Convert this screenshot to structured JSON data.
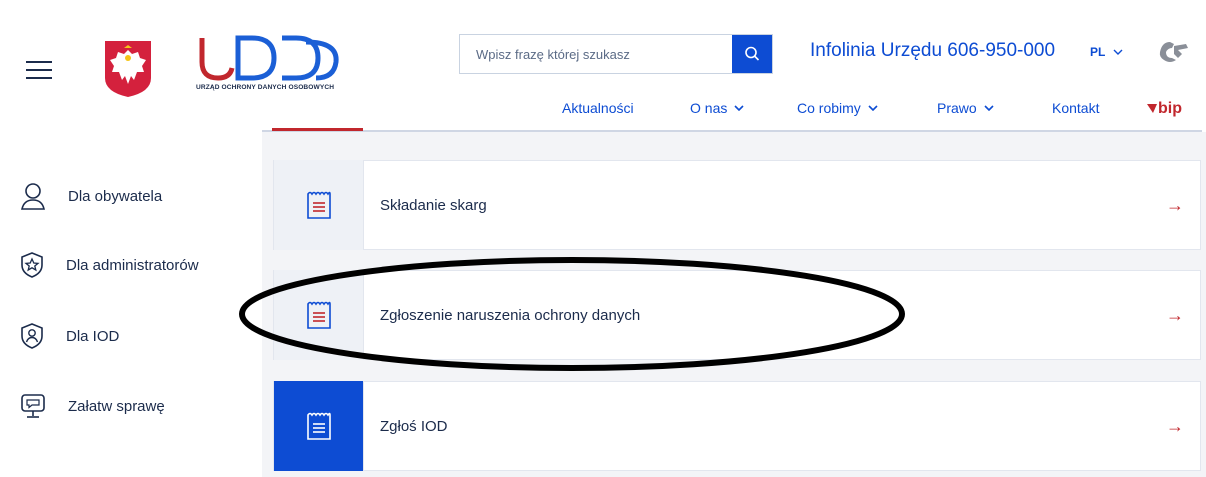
{
  "header": {
    "logo_text": "UODO",
    "logo_subtitle": "URZĄD OCHRONY DANYCH OSOBOWYCH",
    "search_placeholder": "Wpisz frazę której szukasz",
    "hotline": "Infolinia Urzędu 606-950-000",
    "language": "PL",
    "bip_label": "bip"
  },
  "nav": [
    {
      "label": "Aktualności",
      "has_dropdown": false
    },
    {
      "label": "O nas",
      "has_dropdown": true
    },
    {
      "label": "Co robimy",
      "has_dropdown": true
    },
    {
      "label": "Prawo",
      "has_dropdown": true
    },
    {
      "label": "Kontakt",
      "has_dropdown": false
    }
  ],
  "sidebar": {
    "items": [
      {
        "label": "Dla obywatela",
        "icon": "user-icon"
      },
      {
        "label": "Dla administratorów",
        "icon": "shield-star-icon"
      },
      {
        "label": "Dla IOD",
        "icon": "shield-user-icon"
      },
      {
        "label": "Załatw sprawę",
        "icon": "monitor-chat-icon"
      }
    ]
  },
  "cards": [
    {
      "label": "Składanie skarg",
      "icon": "document-icon",
      "active": false
    },
    {
      "label": "Zgłoszenie naruszenia ochrony danych",
      "icon": "document-icon",
      "active": false
    },
    {
      "label": "Zgłoś IOD",
      "icon": "document-icon",
      "active": true
    }
  ],
  "arrow_glyph": "→",
  "colors": {
    "primary_blue": "#0d4cd3",
    "accent_red": "#c1272d",
    "text_dark": "#1b2b4b",
    "annotation_ellipse": "#000000"
  }
}
